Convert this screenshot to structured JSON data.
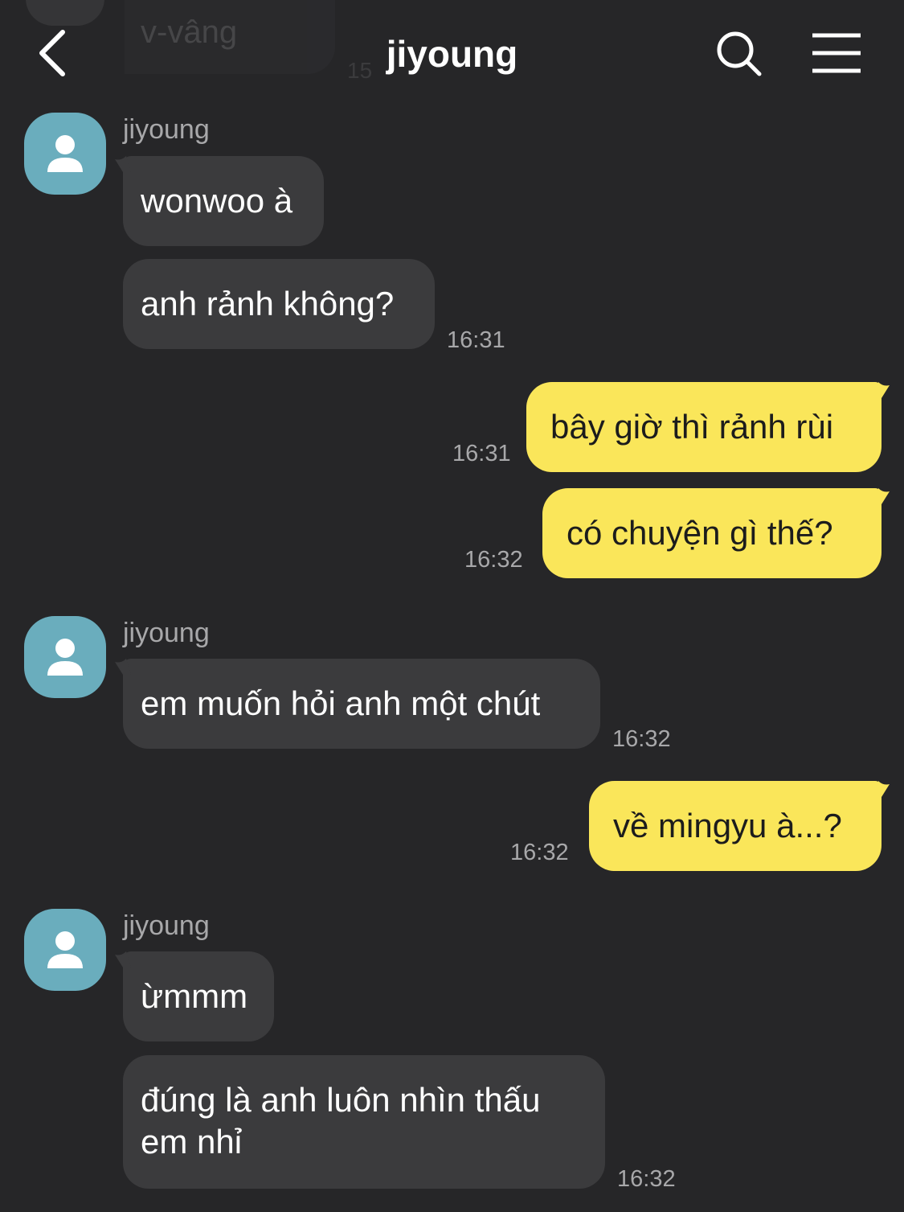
{
  "header": {
    "title": "jiyoung",
    "back_icon": "chevron-left-icon",
    "search_icon": "search-icon",
    "menu_icon": "menu-icon"
  },
  "ghost": {
    "text": "v-vâng",
    "time": "15"
  },
  "colors": {
    "background": "#262628",
    "incoming_bubble": "#3b3b3d",
    "outgoing_bubble": "#fae65a",
    "avatar": "#6aadbd"
  },
  "messages": [
    {
      "sender": "jiyoung",
      "text": "wonwoo à"
    },
    {
      "text": "anh rảnh không?",
      "time": "16:31"
    },
    {
      "text": "bây giờ thì rảnh rùi",
      "time": "16:31"
    },
    {
      "text": "có chuyện gì thế?",
      "time": "16:32"
    },
    {
      "sender": "jiyoung",
      "text": "em muốn hỏi anh một chút",
      "time": "16:32"
    },
    {
      "text": "về mingyu à...?",
      "time": "16:32"
    },
    {
      "sender": "jiyoung",
      "text": "ừmmm"
    },
    {
      "text": "đúng là anh luôn nhìn thấu em nhỉ",
      "time": "16:32"
    }
  ]
}
